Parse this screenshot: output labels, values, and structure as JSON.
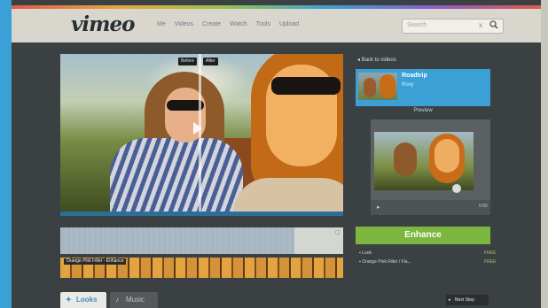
{
  "brand": {
    "logo": "vimeo",
    "accent": "#3aa0d6",
    "enhance_color": "#7bb63e"
  },
  "nav": [
    "Me",
    "Videos",
    "Create",
    "Watch",
    "Tools",
    "Upload"
  ],
  "search": {
    "placeholder": "Search",
    "clear": "x"
  },
  "player": {
    "before_label": "Before",
    "after_label": "After"
  },
  "timeline": {
    "clip_label": "Orange Pink Filter - Enhance"
  },
  "tabs": {
    "looks": "Looks",
    "music": "Music"
  },
  "sidebar": {
    "back": "Back to videos",
    "video_title": "Roadtrip",
    "video_sub": "Roxy",
    "preview_heading": "Preview",
    "preview_right": "0:00",
    "enhance": "Enhance",
    "info": [
      {
        "label": "Look",
        "value": "FREE"
      },
      {
        "label": "Orange Pink Filter / Fla...",
        "value": "FREE"
      }
    ],
    "next": "Next Step"
  }
}
